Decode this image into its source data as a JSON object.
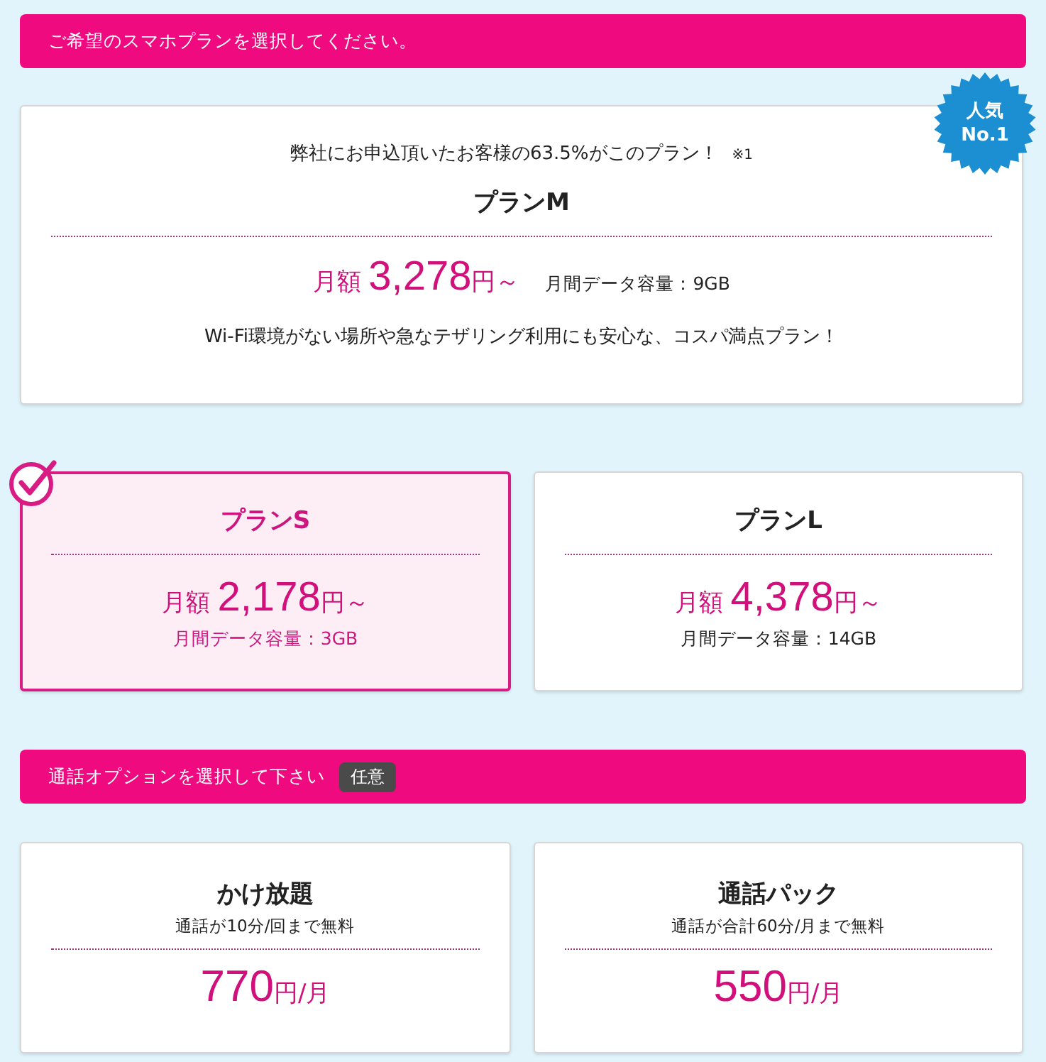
{
  "plan_section": {
    "heading": "ご希望のスマホプランを選択してください。"
  },
  "featured_plan": {
    "note": "弊社にお申込頂いたお客様の63.5%がこのプラン！",
    "note_mark": "※1",
    "badge": {
      "line1": "人気",
      "line2": "No.1"
    },
    "name": "プランM",
    "price_label": "月額",
    "price": "3,278",
    "price_unit": "円～",
    "data": "月間データ容量：9GB",
    "description": "Wi-Fi環境がない場所や急なテザリング利用にも安心な、コスパ満点プラン！",
    "selected": false
  },
  "plans": [
    {
      "name": "プランS",
      "price_label": "月額",
      "price": "2,178",
      "price_unit": "円～",
      "data": "月間データ容量：3GB",
      "selected": true
    },
    {
      "name": "プランL",
      "price_label": "月額",
      "price": "4,378",
      "price_unit": "円～",
      "data": "月間データ容量：14GB",
      "selected": false
    }
  ],
  "option_section": {
    "heading": "通話オプションを選択して下さい",
    "tag": "任意"
  },
  "options": [
    {
      "name": "かけ放題",
      "detail": "通話が10分/回まで無料",
      "price": "770",
      "price_unit": "円/月",
      "selected": false
    },
    {
      "name": "通話パック",
      "detail": "通話が合計60分/月まで無料",
      "price": "550",
      "price_unit": "円/月",
      "selected": false
    }
  ]
}
